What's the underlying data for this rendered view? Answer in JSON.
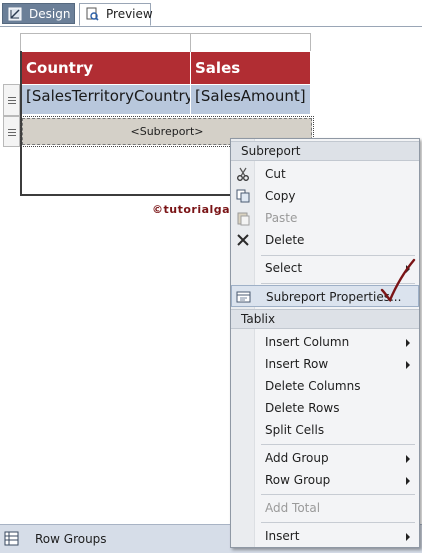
{
  "tabs": {
    "design_label": "Design",
    "preview_label": "Preview"
  },
  "table": {
    "headers": [
      "Country",
      "Sales Amount"
    ],
    "row": [
      "[SalesTerritoryCountry]",
      "[SalesAmount]"
    ],
    "subreport_placeholder": "<Subreport>"
  },
  "watermark": "©tutorialgateway.org",
  "context_menu": {
    "section1_title": "Subreport",
    "cut": "Cut",
    "copy": "Copy",
    "paste": "Paste",
    "delete": "Delete",
    "select": "Select",
    "subreport_properties": "Subreport Properties...",
    "section2_title": "Tablix",
    "insert_column": "Insert Column",
    "insert_row": "Insert Row",
    "delete_columns": "Delete Columns",
    "delete_rows": "Delete Rows",
    "split_cells": "Split Cells",
    "add_group": "Add Group",
    "row_group": "Row Group",
    "add_total": "Add Total",
    "insert": "Insert"
  },
  "grouping_pane": {
    "row_groups_label": "Row Groups"
  },
  "colors": {
    "header_bg": "#b12d33",
    "data_bg": "#b8c7dc",
    "annotation_check": "#7a1416"
  },
  "icons": [
    "design-icon",
    "preview-icon",
    "scissors-icon",
    "copy-icon",
    "paste-icon",
    "delete-x-icon",
    "properties-icon",
    "row-groups-icon",
    "checkmark-annotation-icon"
  ]
}
